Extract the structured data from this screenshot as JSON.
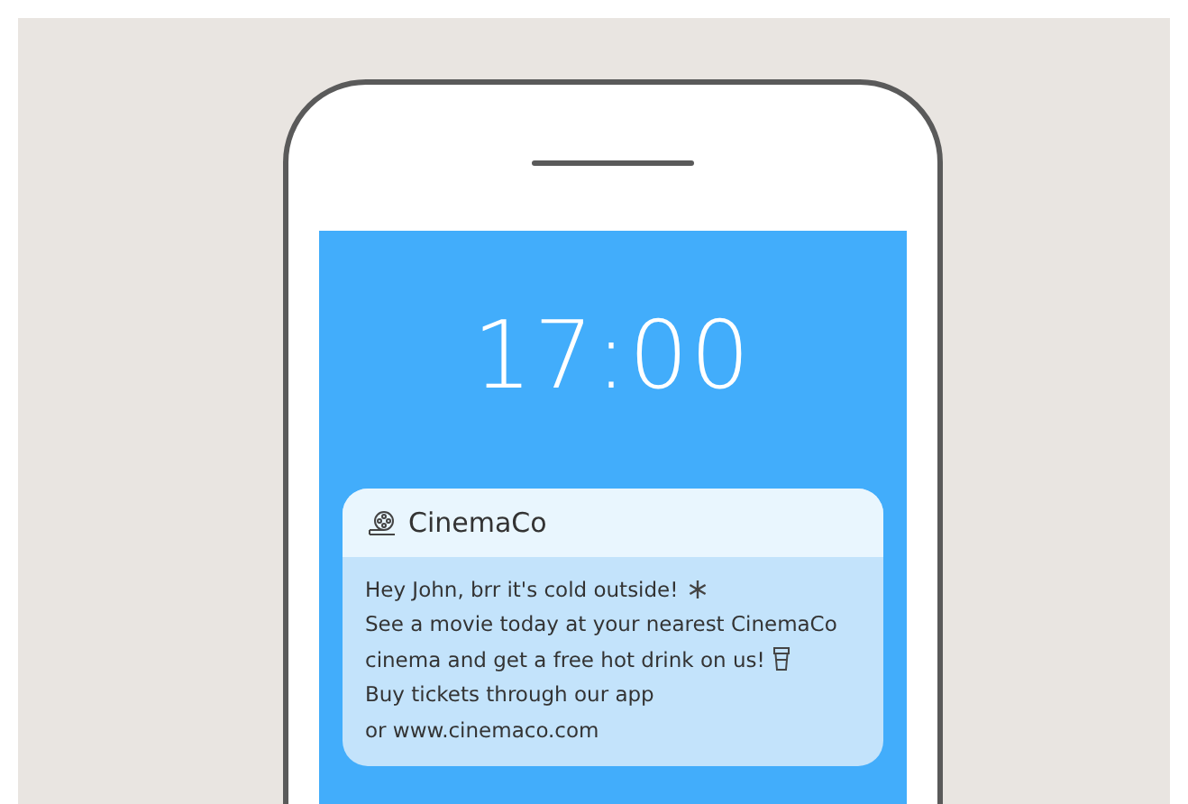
{
  "lock_screen": {
    "time": "17:00"
  },
  "notification": {
    "app_name": "CinemaCo",
    "lines": [
      {
        "text": "Hey John, brr it's cold outside!",
        "kind": "snowflake"
      },
      {
        "text": "See a movie today at your nearest CinemaCo",
        "kind": "text"
      },
      {
        "text": "cinema and get a free hot drink on us!",
        "kind": "cup"
      },
      {
        "text": "Buy tickets through our app",
        "kind": "text"
      },
      {
        "text": "or www.cinemaco.com",
        "kind": "text"
      }
    ]
  }
}
